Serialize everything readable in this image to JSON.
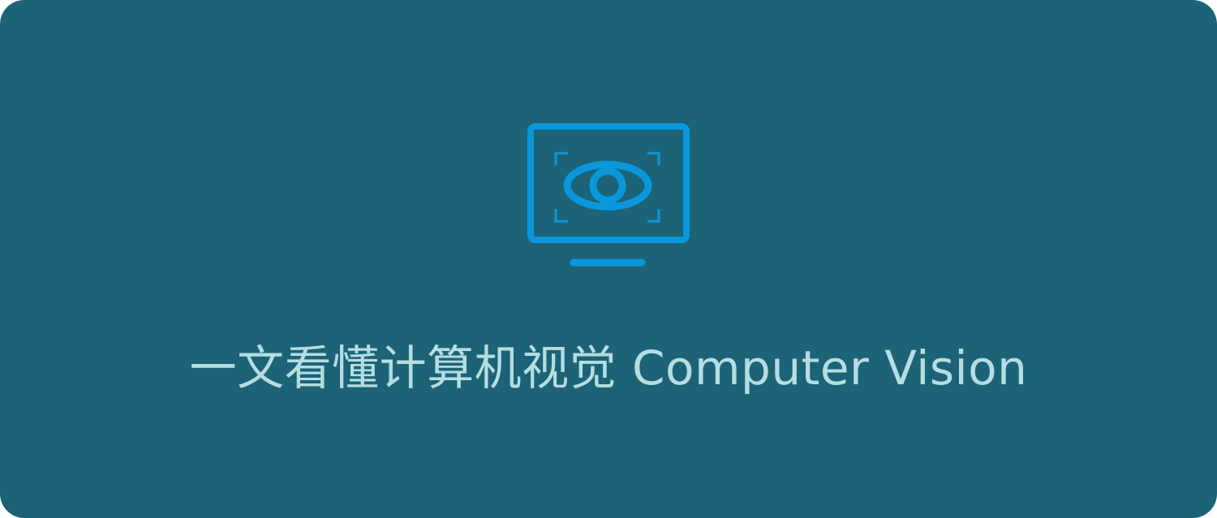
{
  "banner": {
    "title": "一文看懂计算机视觉 Computer Vision",
    "icon": "monitor-eye-icon",
    "colors": {
      "background": "#1c6377",
      "icon": "#0a97dc",
      "title": "#b5dde2"
    }
  }
}
